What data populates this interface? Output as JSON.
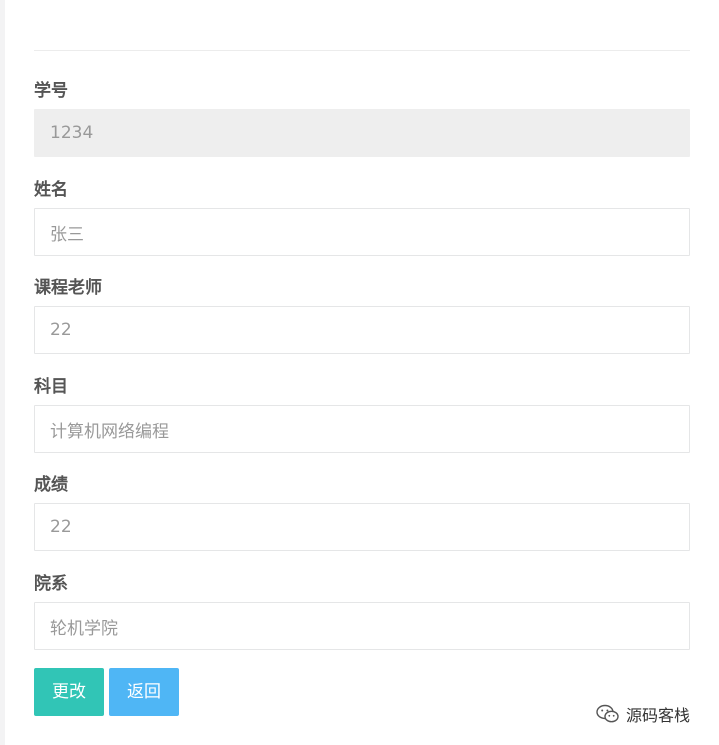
{
  "form": {
    "fields": [
      {
        "label": "学号",
        "value": "1234",
        "readonly": true
      },
      {
        "label": "姓名",
        "value": "张三",
        "readonly": false
      },
      {
        "label": "课程老师",
        "value": "22",
        "readonly": false
      },
      {
        "label": "科目",
        "value": "计算机网络编程",
        "readonly": false
      },
      {
        "label": "成绩",
        "value": "22",
        "readonly": false
      },
      {
        "label": "院系",
        "value": "轮机学院",
        "readonly": false
      }
    ]
  },
  "buttons": {
    "update_label": "更改",
    "back_label": "返回",
    "update_color": "#31c5b6",
    "back_color": "#4fb6f5"
  },
  "watermark": {
    "text": "源码客栈",
    "icon": "wechat-icon"
  }
}
